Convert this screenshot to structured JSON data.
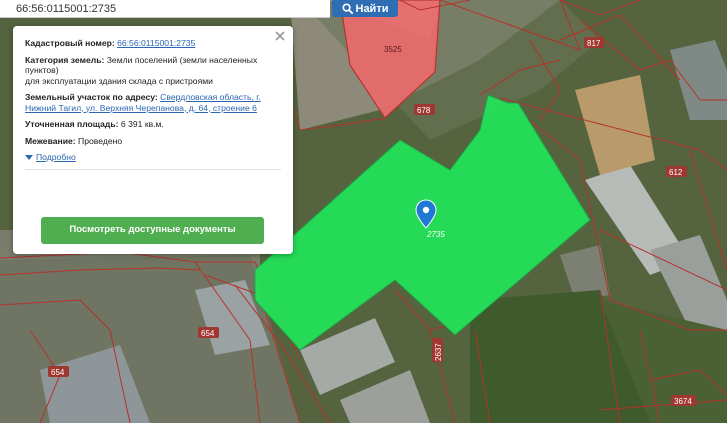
{
  "search": {
    "value": "66:56:0115001:2735",
    "button_label": "Найти"
  },
  "popup": {
    "cadastral_label": "Кадастровый номер:",
    "cadastral_value": "66:56:0115001:2735",
    "category_label": "Категория земель:",
    "category_value": "Земли поселений (земли населенных пунктов)",
    "purpose": "для эксплуатации здания склада с пристроями",
    "address_label": "Земельный участок по адресу:",
    "address_value": "Свердловская область, г. Нижний Тагил, ул. Верхняя Черепанова, д. 64, строение 6",
    "area_label": "Уточненная площадь:",
    "area_value": "6 391 кв.м.",
    "boundary_label": "Межевание:",
    "boundary_value": "Проведено",
    "more_link": "Подробно",
    "docs_button": "Посмотреть доступные документы"
  },
  "map": {
    "labels": {
      "p3525": "3525",
      "p817": "817",
      "p678": "678",
      "p612": "612",
      "p2735": "2735",
      "p654a": "654",
      "p654b": "654",
      "p2637": "2637",
      "p3674": "3674"
    },
    "colors": {
      "selected_parcel": "#22e55a",
      "highlight_parcel": "#e86c6c",
      "boundary": "#b5322a",
      "marker": "#1f78d1"
    }
  }
}
